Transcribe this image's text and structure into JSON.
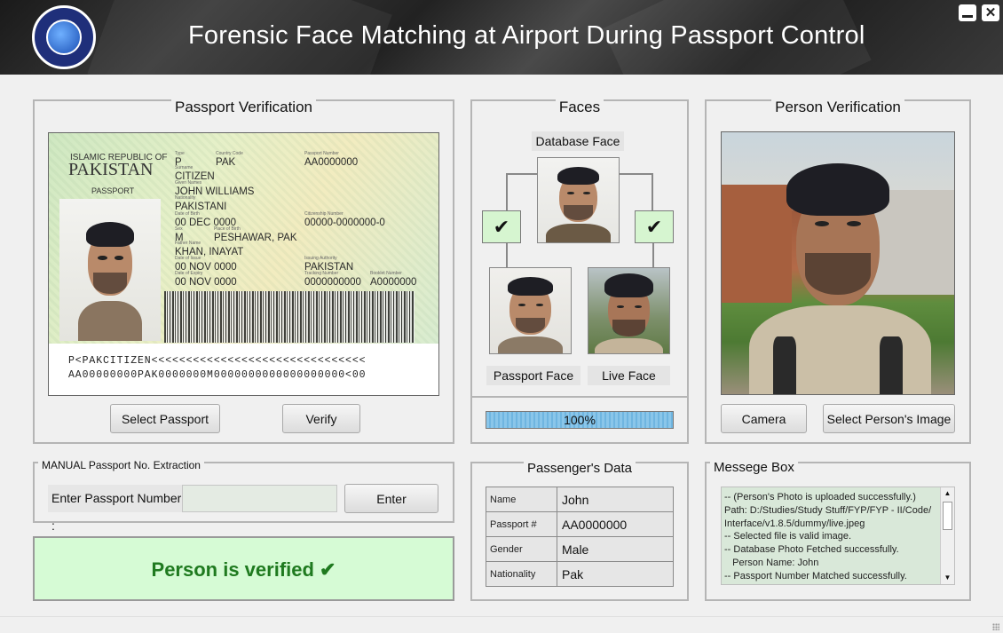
{
  "window": {
    "title": "Forensic Face Matching at Airport During Passport Control",
    "logo_text": "COMSATS UNIVERSITY ISLAMABAD",
    "minimize_icon": "minimize-icon",
    "close_icon": "close-icon"
  },
  "passport_panel": {
    "title": "Passport Verification",
    "passport": {
      "country_line1": "ISLAMIC REPUBLIC OF",
      "country_line2": "PAKISTAN",
      "doc_label": "PASSPORT",
      "type": "P",
      "country_code": "PAK",
      "passport_number": "AA0000000",
      "surname": "CITIZEN",
      "given_names": "JOHN WILLIAMS",
      "nationality": "PAKISTANI",
      "date_of_birth": "00 DEC 0000",
      "citizenship_number": "00000-0000000-0",
      "sex": "M",
      "place_of_birth": "PESHAWAR, PAK",
      "father_name": "KHAN, INAYAT",
      "date_of_issue": "00 NOV 0000",
      "issuing_authority": "PAKISTAN",
      "date_of_expiry": "00 NOV 0000",
      "tracking_number": "0000000000",
      "booklet_number": "A0000000",
      "mrz_line1": "P<PAKCITIZEN<<<<<<<<<<<<<<<<<<<<<<<<<<<<<<<",
      "mrz_line2": "AA00000000PAK0000000M0000000000000000000<00"
    },
    "select_button": "Select Passport",
    "verify_button": "Verify"
  },
  "faces_panel": {
    "title": "Faces",
    "database_face_label": "Database Face",
    "passport_face_label": "Passport Face",
    "live_face_label": "Live Face",
    "check_mark": "✔",
    "progress_value": 100,
    "progress_text": "100%"
  },
  "person_panel": {
    "title": "Person Verification",
    "camera_button": "Camera",
    "select_image_button": "Select Person's Image"
  },
  "manual_panel": {
    "title": "MANUAL Passport No. Extraction",
    "label": "Enter Passport Number :",
    "input_value": "",
    "enter_button": "Enter"
  },
  "result": {
    "text": "Person is verified   ✔",
    "color": "#1f7a1f"
  },
  "passenger_panel": {
    "title": "Passenger's Data",
    "rows": [
      {
        "key": "Name",
        "value": "John"
      },
      {
        "key": "Passport #",
        "value": "AA0000000"
      },
      {
        "key": "Gender",
        "value": "Male"
      },
      {
        "key": "Nationality",
        "value": "Pak"
      }
    ]
  },
  "message_panel": {
    "title": "Messege Box",
    "text": "-- (Person's Photo is uploaded successfully.)\nPath: D:/Studies/Study Stuff/FYP/FYP - II/Code/\nInterface/v1.8.5/dummy/live.jpeg\n-- Selected file is valid image.\n-- Database Photo Fetched successfully.\n   Person Name: John\n-- Passport Number Matched successfully."
  }
}
